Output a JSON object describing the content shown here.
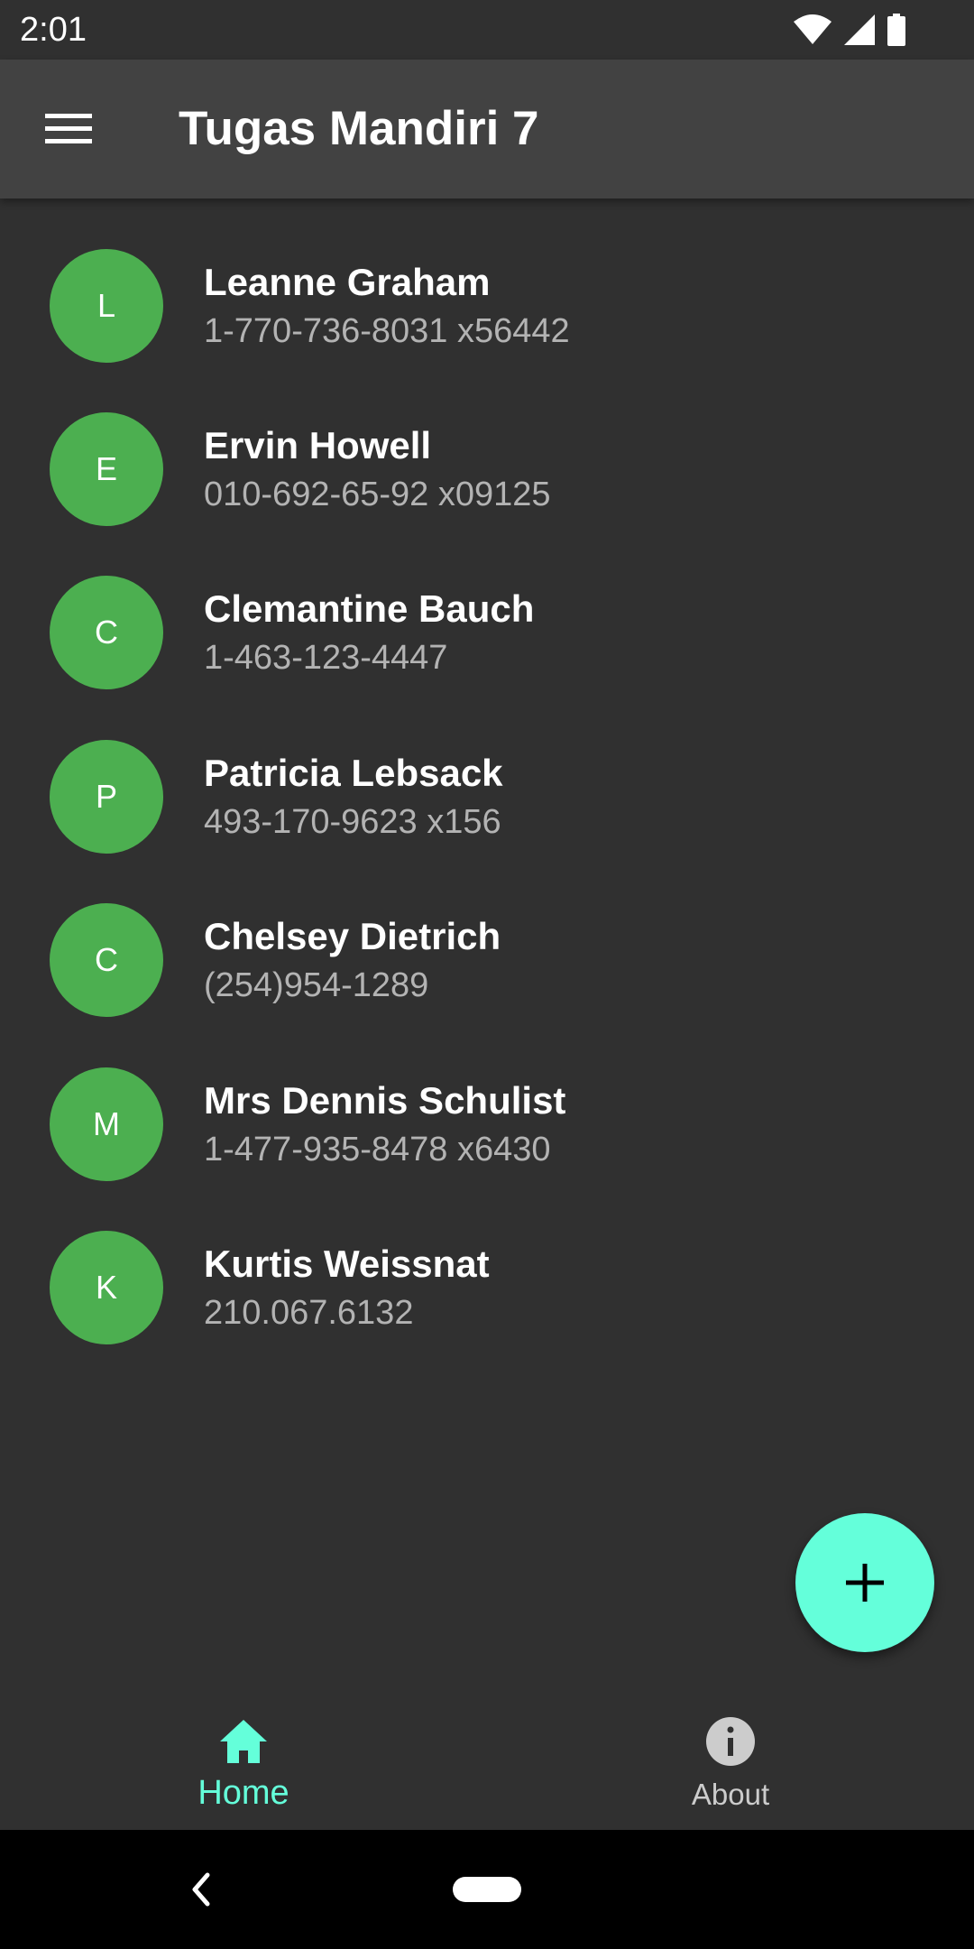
{
  "status_bar": {
    "time": "2:01",
    "icons": [
      "wifi-icon",
      "cell-signal-icon",
      "battery-icon"
    ]
  },
  "app_bar": {
    "title": "Tugas Mandiri 7",
    "menu_icon": "menu-icon"
  },
  "contacts": [
    {
      "initial": "L",
      "name": "Leanne Graham",
      "phone": "1-770-736-8031 x56442"
    },
    {
      "initial": "E",
      "name": "Ervin Howell",
      "phone": "010-692-65-92 x09125"
    },
    {
      "initial": "C",
      "name": "Clemantine Bauch",
      "phone": "1-463-123-4447"
    },
    {
      "initial": "P",
      "name": "Patricia Lebsack",
      "phone": "493-170-9623 x156"
    },
    {
      "initial": "C",
      "name": "Chelsey Dietrich",
      "phone": "(254)954-1289"
    },
    {
      "initial": "M",
      "name": "Mrs Dennis Schulist",
      "phone": "1-477-935-8478 x6430"
    },
    {
      "initial": "K",
      "name": "Kurtis Weissnat",
      "phone": "210.067.6132"
    }
  ],
  "fab": {
    "icon": "plus-icon"
  },
  "bottom_nav": {
    "items": [
      {
        "label": "Home",
        "icon": "home-icon",
        "active": true
      },
      {
        "label": "About",
        "icon": "info-icon",
        "active": false
      }
    ]
  },
  "system_nav": {
    "icons": [
      "back-icon",
      "home-pill-icon"
    ]
  },
  "colors": {
    "background": "#303030",
    "app_bar": "#424242",
    "avatar": "#4caf50",
    "accent": "#64ffda",
    "secondary_text": "#b3b3b3"
  }
}
